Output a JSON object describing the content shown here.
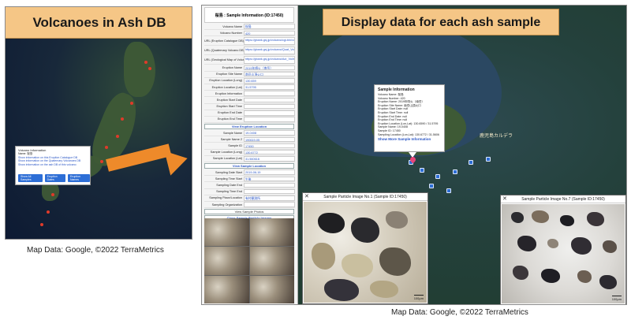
{
  "left": {
    "title": "Volcanoes in Ash DB",
    "caption": "Map Data: Google, ©2022 TerraMetrics",
    "popup": {
      "title": "Volcano Information",
      "lines": [
        "Name: 桜島",
        "Show information on this Eruption Catalogue DB",
        "Show information on the Quaternary Volcanoes DB",
        "Show information on the ash DB of this volcano"
      ],
      "buttons": [
        "Show All Samples",
        "Eruption Dates",
        "Eruption Names"
      ]
    }
  },
  "right": {
    "title": "Display data for each ash sample",
    "caption": "Map Data: Google, ©2022 TerraMetrics",
    "place_label": "鹿児島カルデラ",
    "sheet": {
      "title": "桜島 : Sample Information (ID:17450)",
      "group1": [
        {
          "label": "Volcano Name",
          "value": "桜島"
        },
        {
          "label": "Volcano Number",
          "value": "420"
        },
        {
          "label": "URL (Eruption Catalogue DB)",
          "value": "https://gbank.gsj.jp/volcano/cgi-bin/volcano",
          "tall": true
        },
        {
          "label": "URL (Quaternary Volcano DB)",
          "value": "https://gbank.gsj.jp/volcano/Quat_Vol/volcano",
          "tall": true
        },
        {
          "label": "URL (Geological Map of Volcanoes)",
          "value": "https://gbank.gsj.jp/volcano/Act_Vol/sakura",
          "tall": true
        },
        {
          "label": "Eruption Name",
          "value": "2019年噴火（南岳）"
        },
        {
          "label": "Eruption Site Name",
          "value": "南岳山頂火口"
        },
        {
          "label": "Eruption Location (Long)",
          "value": "130.659"
        },
        {
          "label": "Eruption Location (Lat)",
          "value": "31.5795"
        },
        {
          "label": "Eruption Information",
          "value": ""
        },
        {
          "label": "Eruption Start Date",
          "value": ""
        },
        {
          "label": "Eruption Start Time",
          "value": ""
        },
        {
          "label": "Eruption End Date",
          "value": ""
        },
        {
          "label": "Eruption End Time",
          "value": ""
        }
      ],
      "btn_eruption": "View Eruption Location",
      "group2": [
        {
          "label": "Sample Name",
          "value": "19-0408"
        },
        {
          "label": "Sample Name 2",
          "value": "190619-05"
        },
        {
          "label": "Sample ID",
          "value": "17450"
        },
        {
          "label": "Sample Location (Long)",
          "value": "130.6772"
        },
        {
          "label": "Sample Location (Lat)",
          "value": "31.560616"
        }
      ],
      "btn_sample": "View Sample Location",
      "group3": [
        {
          "label": "Sampling Date Start",
          "value": "2019-06-19"
        },
        {
          "label": "Sampling Time Start",
          "value": "午後"
        },
        {
          "label": "Sampling Date End",
          "value": ""
        },
        {
          "label": "Sampling Time End",
          "value": ""
        },
        {
          "label": "Sampling Place/Location",
          "value": "有村観測所"
        },
        {
          "label": "Sampling Organization",
          "value": ""
        }
      ],
      "btn_photos": "View Sample Photos",
      "btn_close_images": "Close Sample Particle Images"
    },
    "popup": {
      "title": "Sample Information",
      "lines": [
        "Volcano Name: 桜島",
        "Volcano Number: 420",
        "Eruption Name: 2019年噴火（南岳）",
        "Eruption Site Name: 南岳山頂火口",
        "Eruption Start Date: null",
        "Eruption Start Time: null",
        "Eruption End Date: null",
        "Eruption End Time: null",
        "Eruption Location (Lon,Lat): 130.6590 / 31.5795",
        "Sample Name: 19-0408",
        "Sample ID: 17450",
        "Sampling Location (Lon,Lat): 130.6772 / 31.5606"
      ],
      "link": "Show More Sample Information"
    },
    "windows": [
      {
        "title": "Sample Particle Image No.1 (Sample ID:17450)",
        "scale": "100μm"
      },
      {
        "title": "Sample Particle Image No.7 (Sample ID:17450)",
        "scale": "100μm"
      }
    ]
  },
  "colors": {
    "title_bg": "#f5c686",
    "arrow": "#ee8a2a",
    "marker_red": "#e03a2a",
    "marker_blue": "#2d6ed6",
    "link_blue": "#2a56c6"
  }
}
